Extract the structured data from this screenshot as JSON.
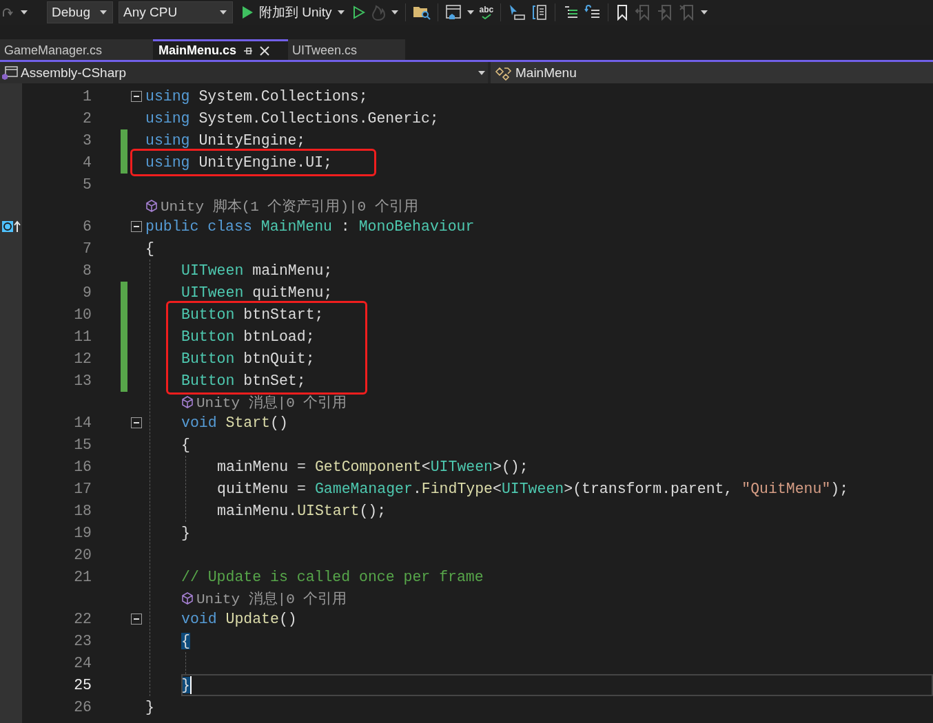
{
  "toolbar": {
    "configuration": "Debug",
    "platform": "Any CPU",
    "start": "附加到 Unity",
    "spellcheck": "abc"
  },
  "tabs": [
    {
      "label": "GameManager.cs",
      "selected": false
    },
    {
      "label": "MainMenu.cs",
      "selected": true
    },
    {
      "label": "UITween.cs",
      "selected": false
    }
  ],
  "navigation": {
    "project": "Assembly-CSharp",
    "type": "MainMenu"
  },
  "code": [
    {
      "kind": "line",
      "number": "1",
      "fold": true,
      "changed": false,
      "current": false,
      "tokens": [
        {
          "kind": "keyword",
          "text": "using"
        },
        {
          "kind": "plain",
          "text": " System.Collections;"
        }
      ]
    },
    {
      "kind": "line",
      "number": "2",
      "fold": false,
      "changed": false,
      "current": false,
      "tokens": [
        {
          "kind": "keyword",
          "text": "using"
        },
        {
          "kind": "plain",
          "text": " System.Collections.Generic;"
        }
      ]
    },
    {
      "kind": "line",
      "number": "3",
      "fold": false,
      "changed": true,
      "current": false,
      "tokens": [
        {
          "kind": "keyword",
          "text": "using"
        },
        {
          "kind": "plain",
          "text": " UnityEngine;"
        }
      ]
    },
    {
      "kind": "box",
      "children": [
        {
          "kind": "line",
          "number": "4",
          "fold": false,
          "changed": true,
          "current": false,
          "tokens": [
            {
              "kind": "keyword",
              "text": "using"
            },
            {
              "kind": "plain",
              "text": " UnityEngine.UI;"
            }
          ]
        }
      ]
    },
    {
      "kind": "line",
      "number": "5",
      "fold": false,
      "changed": false,
      "current": false
    },
    {
      "kind": "codelens",
      "text": "Unity 脚本(1 个资产引用)|0 个引用"
    },
    {
      "kind": "line",
      "number": "6",
      "fold": true,
      "changed": false,
      "current": false,
      "margin_icon": true,
      "tokens": [
        {
          "kind": "keyword",
          "text": "public class"
        },
        {
          "kind": "type",
          "text": " MainMenu"
        },
        {
          "kind": "plain",
          "text": " : "
        },
        {
          "kind": "type",
          "text": "MonoBehaviour"
        }
      ]
    },
    {
      "kind": "line",
      "number": "7",
      "fold": false,
      "changed": false,
      "current": false,
      "tokens": [
        {
          "kind": "plain",
          "text": "{"
        }
      ]
    },
    {
      "kind": "block",
      "children": [
        {
          "kind": "line",
          "number": "8",
          "fold": false,
          "changed": false,
          "current": false,
          "tokens": [
            {
              "kind": "type",
              "text": "UITween"
            },
            {
              "kind": "plain",
              "text": " mainMenu;"
            }
          ]
        },
        {
          "kind": "line",
          "number": "9",
          "fold": false,
          "changed": true,
          "current": false,
          "tokens": [
            {
              "kind": "type",
              "text": "UITween"
            },
            {
              "kind": "plain",
              "text": " quitMenu;"
            }
          ]
        },
        {
          "kind": "box",
          "children": [
            {
              "kind": "line",
              "number": "10",
              "fold": false,
              "changed": true,
              "current": false,
              "tokens": [
                {
                  "kind": "type",
                  "text": "Button"
                },
                {
                  "kind": "plain",
                  "text": " btnStart;"
                }
              ]
            },
            {
              "kind": "line",
              "number": "11",
              "fold": false,
              "changed": true,
              "current": false,
              "tokens": [
                {
                  "kind": "type",
                  "text": "Button"
                },
                {
                  "kind": "plain",
                  "text": " btnLoad;"
                }
              ]
            },
            {
              "kind": "line",
              "number": "12",
              "fold": false,
              "changed": true,
              "current": false,
              "tokens": [
                {
                  "kind": "type",
                  "text": "Button"
                },
                {
                  "kind": "plain",
                  "text": " btnQuit;"
                }
              ]
            },
            {
              "kind": "line",
              "number": "13",
              "fold": false,
              "changed": true,
              "current": false,
              "tokens": [
                {
                  "kind": "type",
                  "text": "Button"
                },
                {
                  "kind": "plain",
                  "text": " btnSet;"
                }
              ]
            }
          ]
        },
        {
          "kind": "codelens",
          "text": "Unity 消息|0 个引用"
        },
        {
          "kind": "line",
          "number": "14",
          "fold": true,
          "changed": false,
          "current": false,
          "tokens": [
            {
              "kind": "keyword",
              "text": "void"
            },
            {
              "kind": "method",
              "text": " Start"
            },
            {
              "kind": "plain",
              "text": "()"
            }
          ]
        },
        {
          "kind": "line",
          "number": "15",
          "fold": false,
          "changed": false,
          "current": false,
          "tokens": [
            {
              "kind": "plain",
              "text": "{"
            }
          ]
        },
        {
          "kind": "block",
          "children": [
            {
              "kind": "line",
              "number": "16",
              "fold": false,
              "changed": false,
              "current": false,
              "tokens": [
                {
                  "kind": "plain",
                  "text": "mainMenu = "
                },
                {
                  "kind": "method",
                  "text": "GetComponent"
                },
                {
                  "kind": "plain",
                  "text": "<"
                },
                {
                  "kind": "type",
                  "text": "UITween"
                },
                {
                  "kind": "plain",
                  "text": ">();"
                }
              ]
            },
            {
              "kind": "line",
              "number": "17",
              "fold": false,
              "changed": false,
              "current": false,
              "tokens": [
                {
                  "kind": "plain",
                  "text": "quitMenu = "
                },
                {
                  "kind": "type",
                  "text": "GameManager"
                },
                {
                  "kind": "plain",
                  "text": "."
                },
                {
                  "kind": "method",
                  "text": "FindType"
                },
                {
                  "kind": "plain",
                  "text": "<"
                },
                {
                  "kind": "type",
                  "text": "UITween"
                },
                {
                  "kind": "plain",
                  "text": ">(transform.parent, "
                },
                {
                  "kind": "string",
                  "text": "\"QuitMenu\""
                },
                {
                  "kind": "plain",
                  "text": ");"
                }
              ]
            },
            {
              "kind": "line",
              "number": "18",
              "fold": false,
              "changed": false,
              "current": false,
              "tokens": [
                {
                  "kind": "plain",
                  "text": "mainMenu."
                },
                {
                  "kind": "method",
                  "text": "UIStart"
                },
                {
                  "kind": "plain",
                  "text": "();"
                }
              ]
            }
          ]
        },
        {
          "kind": "line",
          "number": "19",
          "fold": false,
          "changed": false,
          "current": false,
          "tokens": [
            {
              "kind": "plain",
              "text": "}"
            }
          ]
        },
        {
          "kind": "line",
          "number": "20",
          "fold": false,
          "changed": false,
          "current": false
        },
        {
          "kind": "line",
          "number": "21",
          "fold": false,
          "changed": false,
          "current": false,
          "tokens": [
            {
              "kind": "comment",
              "text": "// Update is called once per frame"
            }
          ]
        },
        {
          "kind": "codelens",
          "text": "Unity 消息|0 个引用"
        },
        {
          "kind": "line",
          "number": "22",
          "fold": true,
          "changed": false,
          "current": false,
          "tokens": [
            {
              "kind": "keyword",
              "text": "void"
            },
            {
              "kind": "method",
              "text": " Update"
            },
            {
              "kind": "plain",
              "text": "()"
            }
          ]
        },
        {
          "kind": "line",
          "number": "23",
          "fold": false,
          "changed": false,
          "current": false,
          "tokens": [
            {
              "kind": "match",
              "text": "{"
            }
          ]
        },
        {
          "kind": "block",
          "children": [
            {
              "kind": "line",
              "number": "24",
              "fold": false,
              "changed": false,
              "current": false
            }
          ]
        },
        {
          "kind": "line",
          "number": "25",
          "fold": false,
          "changed": false,
          "current": true,
          "tokens": [
            {
              "kind": "match",
              "text": "}"
            }
          ]
        }
      ]
    },
    {
      "kind": "line",
      "number": "26",
      "fold": false,
      "changed": false,
      "current": false,
      "tokens": [
        {
          "kind": "plain",
          "text": "}"
        }
      ]
    }
  ]
}
